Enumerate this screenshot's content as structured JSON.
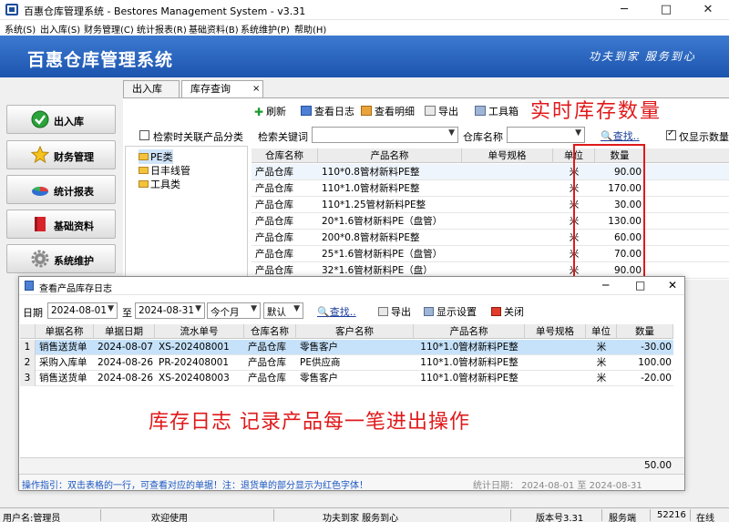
{
  "window": {
    "title": "百惠仓库管理系统 - Bestores Management System - v3.31",
    "minimize": "─",
    "maximize": "□",
    "close": "✕"
  },
  "menu": [
    "系统(S)",
    "出入库(S)",
    "财务管理(C)",
    "统计报表(R)",
    "基础资料(B)",
    "系统维护(P)",
    "帮助(H)"
  ],
  "banner": {
    "title": "百惠仓库管理系统",
    "slogan": "功夫到家  服务到心"
  },
  "sidebar": [
    {
      "label": "出入库",
      "icon": "check-icon"
    },
    {
      "label": "财务管理",
      "icon": "star-icon"
    },
    {
      "label": "统计报表",
      "icon": "pie-chart-icon"
    },
    {
      "label": "基础资料",
      "icon": "book-icon"
    },
    {
      "label": "系统维护",
      "icon": "gear-icon"
    }
  ],
  "tabs": [
    "出入库",
    "库存查询"
  ],
  "tab_close": "×",
  "toolbar": [
    "刷新",
    "查看日志",
    "查看明细",
    "导出",
    "工具箱"
  ],
  "annotation_top": "实时库存数量",
  "filters": {
    "linked_category_label": "检索时关联产品分类",
    "keyword_label": "检索关键词",
    "warehouse_label": "仓库名称",
    "search_button": "查找..",
    "show_qty_label": "仅显示数量"
  },
  "tree": [
    "PE类",
    "日丰线管",
    "工具类"
  ],
  "stock_table": {
    "headers": [
      "仓库名称",
      "产品名称",
      "单号规格",
      "单位",
      "数量"
    ],
    "rows": [
      [
        "产品仓库",
        "110*0.8管材新料PE整",
        "",
        "米",
        "90.00"
      ],
      [
        "产品仓库",
        "110*1.0管材新料PE整",
        "",
        "米",
        "170.00"
      ],
      [
        "产品仓库",
        "110*1.25管材新料PE整",
        "",
        "米",
        "30.00"
      ],
      [
        "产品仓库",
        "20*1.6管材新料PE（盘管）",
        "",
        "米",
        "130.00"
      ],
      [
        "产品仓库",
        "200*0.8管材新料PE整",
        "",
        "米",
        "60.00"
      ],
      [
        "产品仓库",
        "25*1.6管材新料PE（盘管）",
        "",
        "米",
        "70.00"
      ],
      [
        "产品仓库",
        "32*1.6管材新料PE（盘）",
        "",
        "米",
        "90.00"
      ]
    ]
  },
  "dialog": {
    "title": "查看产品库存日志",
    "date_label": "日期",
    "date_from": "2024-08-01",
    "to_label": "至",
    "date_to": "2024-08-31",
    "period": "今个月",
    "sort": "默认",
    "search": "查找..",
    "export": "导出",
    "settings": "显示设置",
    "close": "关闭",
    "headers": [
      "单据名称",
      "单据日期",
      "流水单号",
      "仓库名称",
      "客户名称",
      "产品名称",
      "单号规格",
      "单位",
      "数量"
    ],
    "rows": [
      [
        "1",
        "销售送货单",
        "2024-08-07",
        "XS-202408001",
        "产品仓库",
        "零售客户",
        "110*1.0管材新料PE整",
        "",
        "米",
        "-30.00"
      ],
      [
        "2",
        "采购入库单",
        "2024-08-26",
        "PR-202408001",
        "产品仓库",
        "PE供应商",
        "110*1.0管材新料PE整",
        "",
        "米",
        "100.00"
      ],
      [
        "3",
        "销售送货单",
        "2024-08-26",
        "XS-202408003",
        "产品仓库",
        "零售客户",
        "110*1.0管材新料PE整",
        "",
        "米",
        "-20.00"
      ]
    ],
    "total": "50.00",
    "annotation": "库存日志  记录产品每一笔进出操作"
  },
  "hint": {
    "text": "操作指引：双击表格的一行，可查看对应的单据！注：退货单的部分显示为红色字体！",
    "stat": "统计日期：  2024-08-01  至  2024-08-31"
  },
  "status": {
    "user": "用户名:管理员",
    "welcome": "欢迎使用",
    "slogan": "功夫到家 服务到心",
    "version": "版本号3.31",
    "server": "服务端",
    "port": "52216",
    "online": "在线"
  },
  "colors": {
    "accent": "#1c54ae",
    "annotation": "#e0191a",
    "highlight": "#c6e2fb"
  }
}
